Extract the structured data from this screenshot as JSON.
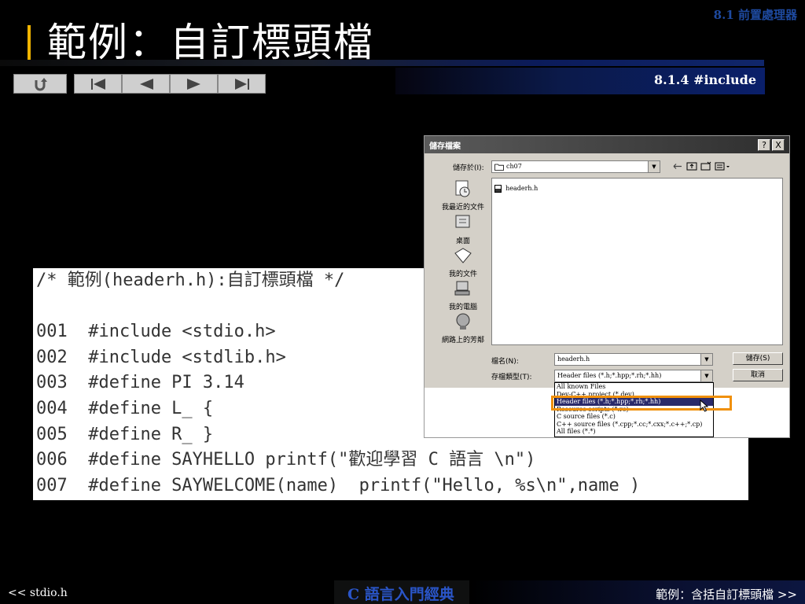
{
  "header": {
    "chapter": "8.1 前置處理器",
    "title": "範例：自訂標頭檔",
    "section": "8.1.4 #include"
  },
  "nav": {
    "buttons": [
      "return-icon",
      "first-icon",
      "prev-icon",
      "next-icon",
      "last-icon"
    ]
  },
  "code": {
    "lines": [
      "/* 範例(headerh.h):自訂標頭檔 */",
      "",
      "001  #include <stdio.h>",
      "002  #include <stdlib.h>",
      "003  #define PI 3.14",
      "004  #define L_ {",
      "005  #define R_ }",
      "006  #define SAYHELLO printf(\"歡迎學習 C 語言 \\n\")",
      "007  #define SAYWELCOME(name)  printf(\"Hello, %s\\n\",name )"
    ]
  },
  "dialog": {
    "title": "儲存檔案",
    "help": "?",
    "close": "X",
    "save_in_label": "儲存於(I):",
    "save_in_value": "ch07",
    "places": [
      "我最近的文件",
      "桌面",
      "我的文件",
      "我的電腦",
      "網路上的芳鄰"
    ],
    "files": [
      "headerh.h"
    ],
    "filename_label": "檔名(N):",
    "filename_value": "headerh.h",
    "filetype_label": "存檔類型(T):",
    "filetype_value": "Header files (*.h;*.hpp;*.rh;*.hh)",
    "save_button": "儲存(S)",
    "cancel_button": "取消",
    "dropdown_options": [
      "All known Files",
      "Dev-C++ project (*.dev)",
      "Header files (*.h;*.hpp;*.rh;*.hh)",
      "Resource scripts (*.rc)",
      "C source files (*.c)",
      "C++ source files (*.cpp;*.cc;*.cxx;*.c++;*.cp)",
      "All files (*.*)"
    ],
    "selected_option_index": 2
  },
  "footer": {
    "prev": "<< stdio.h",
    "book": "C 語言入門經典",
    "next": "範例：含括自訂標頭檔 >>"
  },
  "colors": {
    "accent_bar": "#f0b400",
    "chapter_text": "#1e4aa0",
    "book_text": "#2a55c8",
    "highlight_box": "#f0900a"
  }
}
